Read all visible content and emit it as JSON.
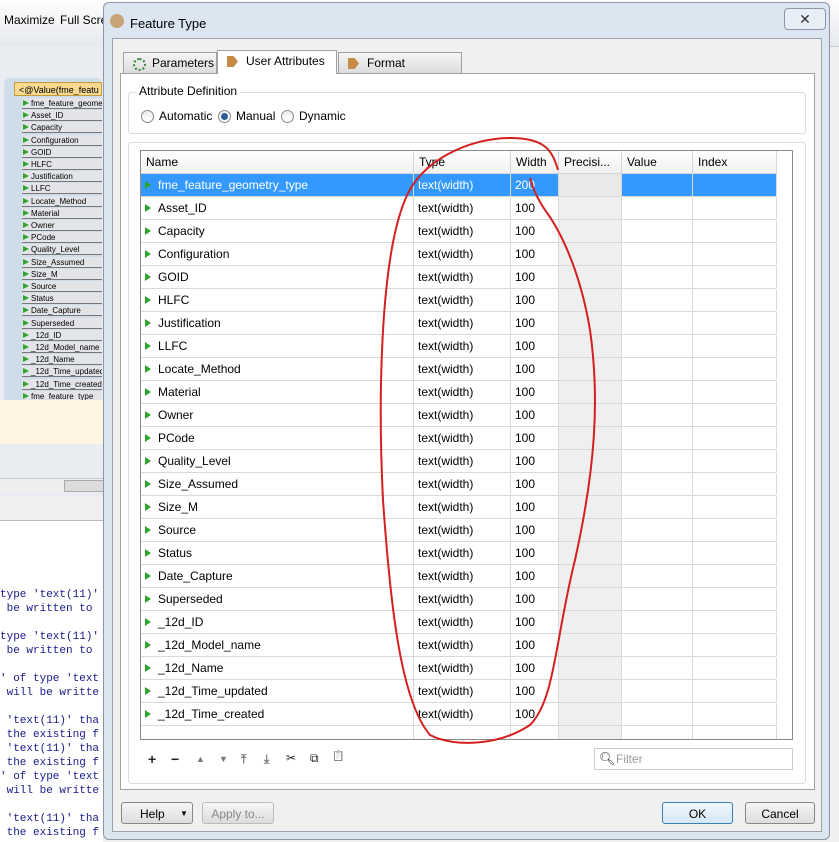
{
  "background_app": {
    "toolbar": {
      "maximize": "Maximize",
      "fullscreen": "Full Scre"
    },
    "tree": {
      "header": "<@Value(fme_featu",
      "items": [
        "fme_feature_geomet",
        "Asset_ID",
        "Capacity",
        "Configuration",
        "GOID",
        "HLFC",
        "Justification",
        "LLFC",
        "Locate_Method",
        "Material",
        "Owner",
        "PCode",
        "Quality_Level",
        "Size_Assumed",
        "Size_M",
        "Source",
        "Status",
        "Date_Capture",
        "Superseded",
        "_12d_ID",
        "_12d_Model_name",
        "_12d_Name",
        "_12d_Time_updated",
        "_12d_Time_created",
        "fme_feature_type"
      ]
    },
    "log_lines": [
      "type 'text(11)'",
      " be written to",
      "type 'text(11)'",
      " be written to",
      "' of type 'text",
      " will be writte",
      " 'text(11)' tha",
      " the existing f",
      " 'text(11)' tha",
      " the existing f",
      "' of type 'text",
      " will be writte",
      " 'text(11)' tha",
      " the existing f"
    ]
  },
  "dialog": {
    "title": "Feature Type",
    "close_icon": "close-icon",
    "tabs": [
      {
        "label": "Parameters",
        "icon": "gear-icon"
      },
      {
        "label": "User Attributes",
        "icon": "arrow-tag-icon",
        "active": true
      },
      {
        "label": "Format Attributes",
        "icon": "arrow-tag-icon"
      }
    ],
    "attribute_definition": {
      "label": "Attribute Definition",
      "options": [
        "Automatic",
        "Manual",
        "Dynamic"
      ],
      "selected": "Manual"
    },
    "table": {
      "columns": [
        "Name",
        "Type",
        "Width",
        "Precisi...",
        "Value",
        "Index"
      ],
      "rows": [
        [
          "fme_feature_geometry_type",
          "text(width)",
          "200"
        ],
        [
          "Asset_ID",
          "text(width)",
          "100"
        ],
        [
          "Capacity",
          "text(width)",
          "100"
        ],
        [
          "Configuration",
          "text(width)",
          "100"
        ],
        [
          "GOID",
          "text(width)",
          "100"
        ],
        [
          "HLFC",
          "text(width)",
          "100"
        ],
        [
          "Justification",
          "text(width)",
          "100"
        ],
        [
          "LLFC",
          "text(width)",
          "100"
        ],
        [
          "Locate_Method",
          "text(width)",
          "100"
        ],
        [
          "Material",
          "text(width)",
          "100"
        ],
        [
          "Owner",
          "text(width)",
          "100"
        ],
        [
          "PCode",
          "text(width)",
          "100"
        ],
        [
          "Quality_Level",
          "text(width)",
          "100"
        ],
        [
          "Size_Assumed",
          "text(width)",
          "100"
        ],
        [
          "Size_M",
          "text(width)",
          "100"
        ],
        [
          "Source",
          "text(width)",
          "100"
        ],
        [
          "Status",
          "text(width)",
          "100"
        ],
        [
          "Date_Capture",
          "text(width)",
          "100"
        ],
        [
          "Superseded",
          "text(width)",
          "100"
        ],
        [
          "_12d_ID",
          "text(width)",
          "100"
        ],
        [
          "_12d_Model_name",
          "text(width)",
          "100"
        ],
        [
          "_12d_Name",
          "text(width)",
          "100"
        ],
        [
          "_12d_Time_updated",
          "text(width)",
          "100"
        ],
        [
          "_12d_Time_created",
          "text(width)",
          "100"
        ]
      ],
      "selected_row": 0
    },
    "toolbar": {
      "add": "+",
      "remove": "−",
      "up": "▲",
      "down": "▼",
      "top": "⤒",
      "bottom": "⤓",
      "cut": "✂",
      "copy": "⧉",
      "paste": "📋"
    },
    "filter": {
      "placeholder": "Filter"
    },
    "buttons": {
      "help": "Help",
      "apply": "Apply to...",
      "ok": "OK",
      "cancel": "Cancel"
    }
  },
  "annotation_color": "#d42020"
}
